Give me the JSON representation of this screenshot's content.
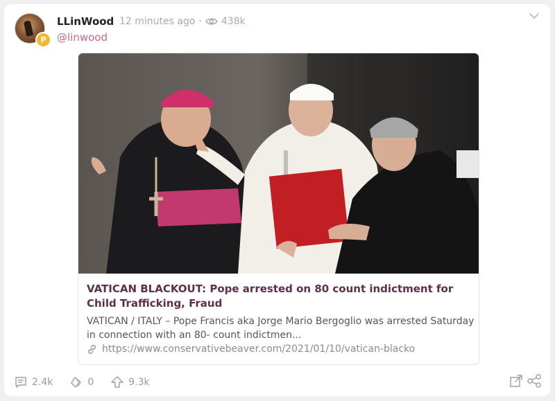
{
  "post": {
    "author": {
      "name": "LLinWood",
      "handle": "@linwood",
      "badge_letter": "P"
    },
    "time": "12 minutes ago",
    "separator": "·",
    "views": "438k",
    "card": {
      "title": "VATICAN BLACKOUT: Pope arrested on 80 count indictment for Child Trafficking, Fraud",
      "description": "VATICAN / ITALY – Pope Francis aka Jorge Mario Bergoglio was arrested Saturday in connection with an 80- count indictmen...",
      "url": "https://www.conservativebeaver.com/2021/01/10/vatican-blacko"
    },
    "actions": {
      "comments": "2.4k",
      "reposts": "0",
      "upvotes": "9.3k"
    }
  },
  "colors": {
    "title_color": "#5f2f49",
    "handle_color": "#c26a86",
    "badge_color": "#f2b733",
    "muted_text": "#a8a8ae"
  }
}
